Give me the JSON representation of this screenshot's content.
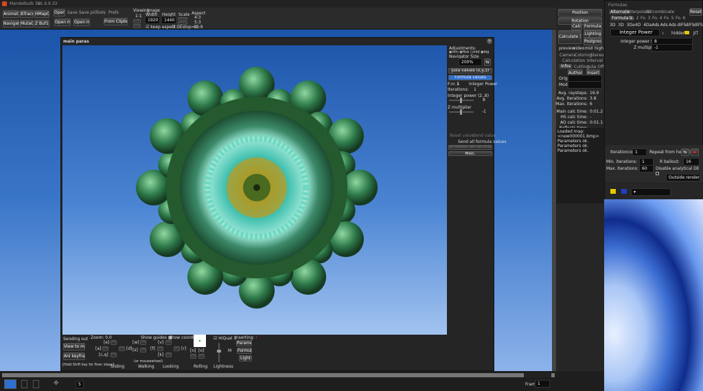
{
  "app": {
    "title": "Mandelbulb 3D",
    "version": "v1.9.9.33"
  },
  "toolbar": {
    "left_buttons": [
      "Animations",
      "BTracer2",
      "HMapGen",
      "Navigator",
      "MutaGen",
      "Z Buf16Bit"
    ],
    "menu_tabs": [
      "Open",
      "Save",
      "Save pic",
      "Tools",
      "Prefs"
    ],
    "open_m3i": "Open m3i",
    "open_m3p": "Open m3p",
    "from_clipboard": "From Clipboard",
    "viewing_label": "Viewing",
    "viewing_value": "1:1",
    "image_label": "Image",
    "width_label": "Width",
    "width_value": "1920",
    "height_label": "Height",
    "height_value": "1440",
    "keep_aspect": "keep aspect",
    "de_stop": "DEstop=C",
    "scale_label": "Scale",
    "aspect_label": "Aspect",
    "aspects": [
      "4:3",
      "5:3",
      "16:9"
    ]
  },
  "right_panel": {
    "position": "Position",
    "rotation": "Rotation",
    "calc": "Calc",
    "formulas": "Formulas",
    "calculate_3d": "Calculate 3D",
    "lighting": "Lighting",
    "postprocess": "Postprocess",
    "quality": [
      "preview",
      "video",
      "mid",
      "high"
    ],
    "tabs_row1": [
      "Camera",
      "Coloring",
      "Stereo"
    ],
    "tabs_row2": [
      "Calculation",
      "Interval"
    ],
    "tabs_row3": [
      "Infos",
      "Cutting",
      "Julia Off"
    ],
    "author": "Author",
    "insert": "Insert",
    "orig_label": "Orig:",
    "mod_label": "Mod:",
    "stats": [
      {
        "label": "Avg. raysteps:",
        "value": "16.9"
      },
      {
        "label": "Avg. iterations:",
        "value": "3.8"
      },
      {
        "label": "Max. iterations:",
        "value": "6"
      },
      {
        "label": "Main calc time:",
        "value": "0:01.2"
      },
      {
        "label": "HS calc time:",
        "value": "-"
      },
      {
        "label": "AO calc time:",
        "value": "0:01.1"
      },
      {
        "label": "Reflects time:",
        "value": "-"
      }
    ],
    "log": [
      "Loaded map:",
      "<new000001.bmp>",
      "Parameters ok.",
      "Parameters ok.",
      "Parameters ok."
    ]
  },
  "main_paras": {
    "title": "main paras",
    "adjustments_label": "Adjustments:",
    "sizes": [
      "min",
      "fine",
      "mid",
      "big"
    ],
    "navigator_size_label": "Navigator Size",
    "navigator_size": "200%",
    "julia_values": "Julia values (x,y,z)",
    "formula_values": "Formula values",
    "f_nr_label": "F.nr.",
    "f_nr": "1",
    "formula_name": "Integer Power",
    "iterations_label": "Iterations:",
    "iterations": "1",
    "int_power_label": "Integer power (2..8)",
    "int_power": "8",
    "z_mult_label": "Z multiplier",
    "z_mult": "-1",
    "reset_value": "Reset value",
    "send_value": "Send value",
    "send_all": "Send all formula values",
    "rotation_btn": "fix rotation (ant yet m3d)",
    "misc": "Misc.",
    "sending_out": "Sending out",
    "zoom_label": "Zoom: 0.0",
    "view_to_main": "View to main",
    "ani_keyframe": "Ani keyframe",
    "shift_hint": "[Hold Shift key for finer steps]",
    "show_guides": "Show guides",
    "show_coords": "Show coords",
    "hiqual": "HiQual 1",
    "inserting": "Inserting:",
    "parameter": "Parameter",
    "formula": "Formula",
    "light": "Light",
    "sliding": "Sliding",
    "walking": "Walking",
    "looking": "Looking",
    "rolling": "Rolling",
    "lightness": "Lightness",
    "mousewheel": "(or mousewheel)",
    "keys": [
      "[w]",
      "[a]",
      "[d]",
      "[s]",
      "[c,q]",
      "[e]",
      "[v]",
      "[f]",
      "[r]",
      "[k]",
      "[n]",
      "[o]",
      "M"
    ]
  },
  "formulas_window": {
    "title": "Formulas",
    "tabs": [
      "Alternate",
      "Interpolate",
      "DEcombinate"
    ],
    "reset": "Reset",
    "formula_tabs": [
      "Formula 1",
      "Fo. 2",
      "Fo. 3",
      "Fo. 4",
      "Fo. 5",
      "Fo. 6"
    ],
    "dims": [
      "3D",
      "3D",
      "3Da",
      "4D",
      "4Da",
      "Ads",
      "Ads",
      "Ads",
      "dIFS",
      "dIFS",
      "dIFS"
    ],
    "formula_name": "Integer Power",
    "hidden": "hidden",
    "jit": "JIT",
    "params": [
      {
        "label": "Integer power (2..8)",
        "value": "8"
      },
      {
        "label": "Z multiplier",
        "value": "-1"
      }
    ],
    "iteration_count_label": "Iterationcount",
    "iteration_count": "1",
    "repeat_from_here": "Repeat from here",
    "min_it_label": "Min. iterations:",
    "min_it": "1",
    "max_it_label": "Max. iterations:",
    "max_it": "60",
    "r_bailout_label": "R bailout:",
    "r_bailout": "16",
    "disable_de": "Disable analytical DE",
    "outside_render": "Outside render"
  },
  "bottom": {
    "frame_label": "Frame",
    "frame_value": "1",
    "step": "5"
  },
  "colors": {
    "accent": "#2f6fd0",
    "panel": "#2a2a2a",
    "render_top": "#1b54a8",
    "render_bottom": "#8db3ea"
  }
}
